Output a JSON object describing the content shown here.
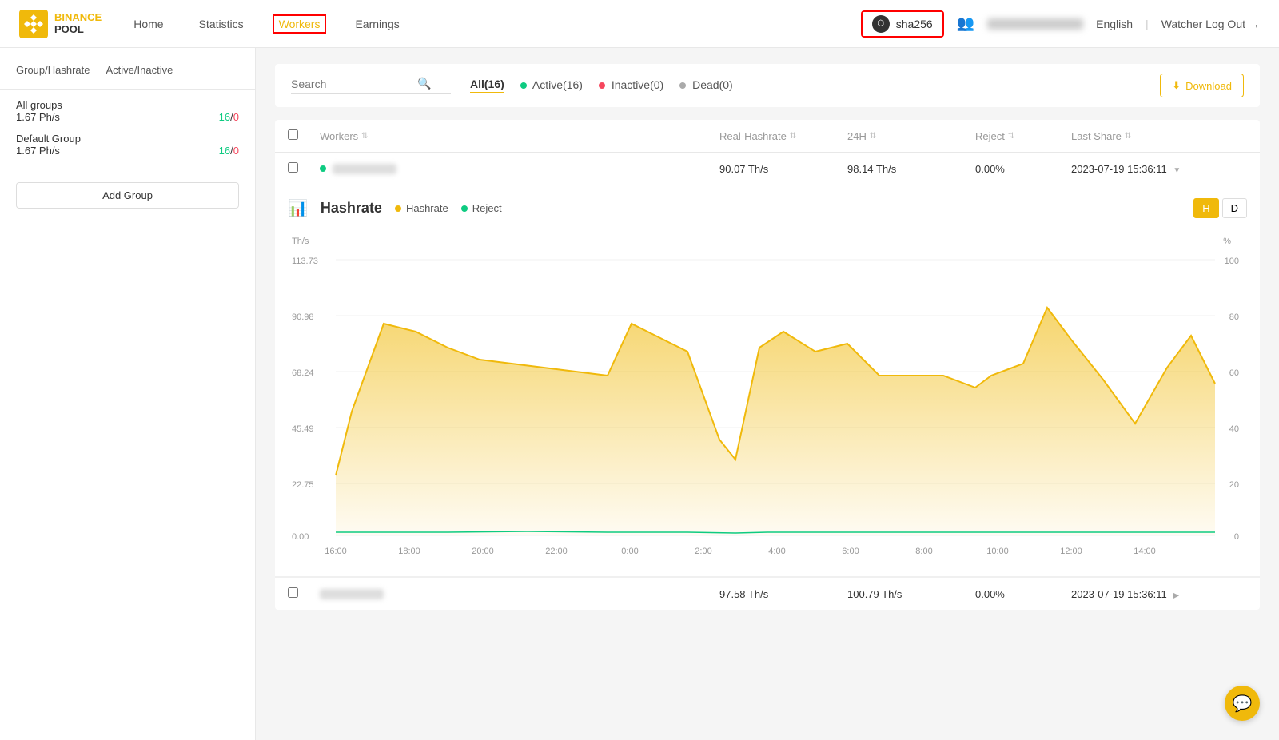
{
  "header": {
    "logo_binance": "BINANCE",
    "logo_pool": "POOL",
    "nav": [
      {
        "label": "Home",
        "id": "home",
        "active": false
      },
      {
        "label": "Statistics",
        "id": "statistics",
        "active": false
      },
      {
        "label": "Workers",
        "id": "workers",
        "active": true
      },
      {
        "label": "Earnings",
        "id": "earnings",
        "active": false
      }
    ],
    "algo": "sha256",
    "language": "English",
    "logout_label": "Watcher Log Out"
  },
  "sidebar": {
    "tab1": "Group/Hashrate",
    "tab2": "Active/Inactive",
    "groups": [
      {
        "name": "All groups",
        "hashrate": "1.67 Ph/s",
        "active": "16",
        "inactive": "0"
      },
      {
        "name": "Default Group",
        "hashrate": "1.67 Ph/s",
        "active": "16",
        "inactive": "0"
      }
    ],
    "add_group_label": "Add Group"
  },
  "filter_bar": {
    "search_placeholder": "Search",
    "tabs": [
      {
        "label": "All(16)",
        "dot": null,
        "active": true
      },
      {
        "label": "Active(16)",
        "dot": "green",
        "active": false
      },
      {
        "label": "Inactive(0)",
        "dot": "red",
        "active": false
      },
      {
        "label": "Dead(0)",
        "dot": "gray",
        "active": false
      }
    ],
    "download_label": "Download"
  },
  "table": {
    "columns": [
      "Workers",
      "Real-Hashrate",
      "24H",
      "Reject",
      "Last Share"
    ],
    "row1": {
      "worker_name_blur": true,
      "real_hashrate": "90.07 Th/s",
      "h24": "98.14 Th/s",
      "reject": "0.00%",
      "last_share": "2023-07-19 15:36:11",
      "active": true
    },
    "row_bottom": {
      "worker_name_blur": true,
      "real_hashrate": "97.58 Th/s",
      "h24": "100.79 Th/s",
      "reject": "0.00%",
      "last_share": "2023-07-19 15:36:11"
    }
  },
  "chart": {
    "title": "Hashrate",
    "legend_hashrate": "Hashrate",
    "legend_reject": "Reject",
    "period_h": "H",
    "period_d": "D",
    "y_labels": [
      "113.73",
      "90.98",
      "68.24",
      "45.49",
      "22.75",
      "0.00"
    ],
    "y_right_labels": [
      "100",
      "80",
      "60",
      "40",
      "20",
      "0"
    ],
    "x_labels": [
      "16:00",
      "18:00",
      "20:00",
      "22:00",
      "0:00",
      "2:00",
      "4:00",
      "6:00",
      "8:00",
      "10:00",
      "12:00",
      "14:00"
    ],
    "y_axis_label": "Th/s",
    "y_right_label": "%"
  }
}
